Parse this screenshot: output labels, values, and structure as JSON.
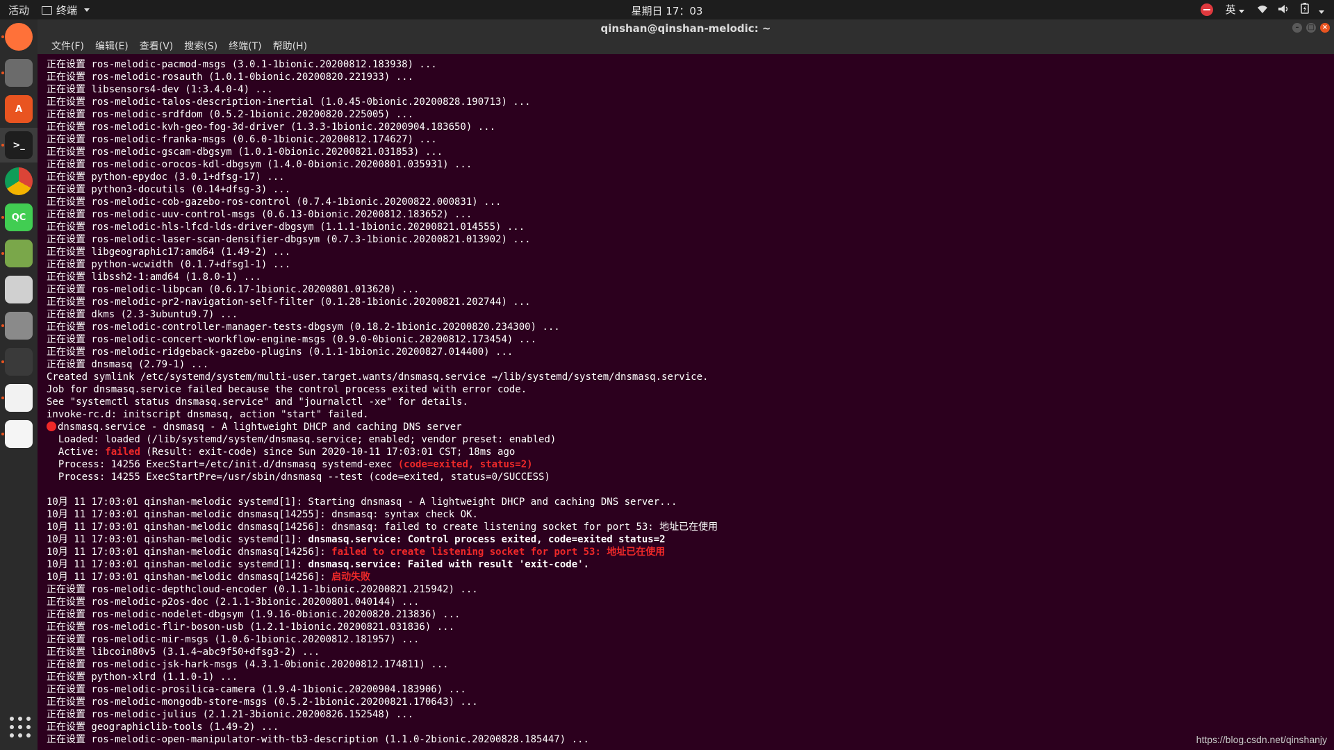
{
  "topbar": {
    "activities": "活动",
    "app_name": "终端",
    "clock": "星期日 17：03",
    "input_method": "英"
  },
  "window": {
    "title": "qinshan@qinshan-melodic: ~",
    "menu": [
      "文件(F)",
      "编辑(E)",
      "查看(V)",
      "搜索(S)",
      "终端(T)",
      "帮助(H)"
    ]
  },
  "dock": [
    {
      "name": "firefox-icon",
      "label": ""
    },
    {
      "name": "files-icon",
      "label": ""
    },
    {
      "name": "software-center-icon",
      "label": "A"
    },
    {
      "name": "terminal-icon",
      "label": ">_"
    },
    {
      "name": "chrome-icon",
      "label": ""
    },
    {
      "name": "qtcreator-icon",
      "label": "QC"
    },
    {
      "name": "image-editor-icon",
      "label": ""
    },
    {
      "name": "camera-icon",
      "label": ""
    },
    {
      "name": "settings-tools-icon",
      "label": ""
    },
    {
      "name": "video-editor-icon",
      "label": ""
    },
    {
      "name": "text-editor-icon",
      "label": ""
    },
    {
      "name": "document-viewer-icon",
      "label": ""
    }
  ],
  "terminal": {
    "lines": [
      [
        {
          "t": "正在设置 ros-melodic-pacmod-msgs (3.0.1-1bionic.20200812.183938) ..."
        }
      ],
      [
        {
          "t": "正在设置 ros-melodic-rosauth (1.0.1-0bionic.20200820.221933) ..."
        }
      ],
      [
        {
          "t": "正在设置 libsensors4-dev (1:3.4.0-4) ..."
        }
      ],
      [
        {
          "t": "正在设置 ros-melodic-talos-description-inertial (1.0.45-0bionic.20200828.190713) ..."
        }
      ],
      [
        {
          "t": "正在设置 ros-melodic-srdfdom (0.5.2-1bionic.20200820.225005) ..."
        }
      ],
      [
        {
          "t": "正在设置 ros-melodic-kvh-geo-fog-3d-driver (1.3.3-1bionic.20200904.183650) ..."
        }
      ],
      [
        {
          "t": "正在设置 ros-melodic-franka-msgs (0.6.0-1bionic.20200812.174627) ..."
        }
      ],
      [
        {
          "t": "正在设置 ros-melodic-gscam-dbgsym (1.0.1-0bionic.20200821.031853) ..."
        }
      ],
      [
        {
          "t": "正在设置 ros-melodic-orocos-kdl-dbgsym (1.4.0-0bionic.20200801.035931) ..."
        }
      ],
      [
        {
          "t": "正在设置 python-epydoc (3.0.1+dfsg-17) ..."
        }
      ],
      [
        {
          "t": "正在设置 python3-docutils (0.14+dfsg-3) ..."
        }
      ],
      [
        {
          "t": "正在设置 ros-melodic-cob-gazebo-ros-control (0.7.4-1bionic.20200822.000831) ..."
        }
      ],
      [
        {
          "t": "正在设置 ros-melodic-uuv-control-msgs (0.6.13-0bionic.20200812.183652) ..."
        }
      ],
      [
        {
          "t": "正在设置 ros-melodic-hls-lfcd-lds-driver-dbgsym (1.1.1-1bionic.20200821.014555) ..."
        }
      ],
      [
        {
          "t": "正在设置 ros-melodic-laser-scan-densifier-dbgsym (0.7.3-1bionic.20200821.013902) ..."
        }
      ],
      [
        {
          "t": "正在设置 libgeographic17:amd64 (1.49-2) ..."
        }
      ],
      [
        {
          "t": "正在设置 python-wcwidth (0.1.7+dfsg1-1) ..."
        }
      ],
      [
        {
          "t": "正在设置 libssh2-1:amd64 (1.8.0-1) ..."
        }
      ],
      [
        {
          "t": "正在设置 ros-melodic-libpcan (0.6.17-1bionic.20200801.013620) ..."
        }
      ],
      [
        {
          "t": "正在设置 ros-melodic-pr2-navigation-self-filter (0.1.28-1bionic.20200821.202744) ..."
        }
      ],
      [
        {
          "t": "正在设置 dkms (2.3-3ubuntu9.7) ..."
        }
      ],
      [
        {
          "t": "正在设置 ros-melodic-controller-manager-tests-dbgsym (0.18.2-1bionic.20200820.234300) ..."
        }
      ],
      [
        {
          "t": "正在设置 ros-melodic-concert-workflow-engine-msgs (0.9.0-0bionic.20200812.173454) ..."
        }
      ],
      [
        {
          "t": "正在设置 ros-melodic-ridgeback-gazebo-plugins (0.1.1-1bionic.20200827.014400) ..."
        }
      ],
      [
        {
          "t": "正在设置 dnsmasq (2.79-1) ..."
        }
      ],
      [
        {
          "t": "Created symlink /etc/systemd/system/multi-user.target.wants/dnsmasq.service →/lib/systemd/system/dnsmasq.service."
        }
      ],
      [
        {
          "t": "Job for dnsmasq.service failed because the control process exited with error code."
        }
      ],
      [
        {
          "t": "See \"systemctl status dnsmasq.service\" and \"journalctl -xe\" for details."
        }
      ],
      [
        {
          "t": "invoke-rc.d: initscript dnsmasq, action \"start\" failed."
        }
      ],
      [
        {
          "bullet": true
        },
        {
          "t": "dnsmasq.service - dnsmasq - A lightweight DHCP and caching DNS server"
        }
      ],
      [
        {
          "t": "  Loaded: loaded (/lib/systemd/system/dnsmasq.service; enabled; vendor preset: enabled)"
        }
      ],
      [
        {
          "t": "  Active: "
        },
        {
          "t": "failed",
          "c": "red bold"
        },
        {
          "t": " (Result: exit-code) since Sun 2020-10-11 17:03:01 CST; 18ms ago"
        }
      ],
      [
        {
          "t": "  Process: 14256 ExecStart=/etc/init.d/dnsmasq systemd-exec "
        },
        {
          "t": "(code=exited, status=2)",
          "c": "red bold"
        }
      ],
      [
        {
          "t": "  Process: 14255 ExecStartPre=/usr/sbin/dnsmasq --test (code=exited, status=0/SUCCESS)"
        }
      ],
      [
        {
          "t": ""
        }
      ],
      [
        {
          "t": "10月 11 17:03:01 qinshan-melodic systemd[1]: Starting dnsmasq - A lightweight DHCP and caching DNS server..."
        }
      ],
      [
        {
          "t": "10月 11 17:03:01 qinshan-melodic dnsmasq[14255]: dnsmasq: syntax check OK."
        }
      ],
      [
        {
          "t": "10月 11 17:03:01 qinshan-melodic dnsmasq[14256]: dnsmasq: failed to create listening socket for port 53: 地址已在使用"
        }
      ],
      [
        {
          "t": "10月 11 17:03:01 qinshan-melodic systemd[1]: "
        },
        {
          "t": "dnsmasq.service: Control process exited, code=exited status=2",
          "c": "bold"
        }
      ],
      [
        {
          "t": "10月 11 17:03:01 qinshan-melodic dnsmasq[14256]: "
        },
        {
          "t": "failed to create listening socket for port 53: 地址已在使用",
          "c": "red bold"
        }
      ],
      [
        {
          "t": "10月 11 17:03:01 qinshan-melodic systemd[1]: "
        },
        {
          "t": "dnsmasq.service: Failed with result 'exit-code'.",
          "c": "bold"
        }
      ],
      [
        {
          "t": "10月 11 17:03:01 qinshan-melodic dnsmasq[14256]: "
        },
        {
          "t": "启动失败",
          "c": "red bold"
        }
      ],
      [
        {
          "t": "正在设置 ros-melodic-depthcloud-encoder (0.1.1-1bionic.20200821.215942) ..."
        }
      ],
      [
        {
          "t": "正在设置 ros-melodic-p2os-doc (2.1.1-3bionic.20200801.040144) ..."
        }
      ],
      [
        {
          "t": "正在设置 ros-melodic-nodelet-dbgsym (1.9.16-0bionic.20200820.213836) ..."
        }
      ],
      [
        {
          "t": "正在设置 ros-melodic-flir-boson-usb (1.2.1-1bionic.20200821.031836) ..."
        }
      ],
      [
        {
          "t": "正在设置 ros-melodic-mir-msgs (1.0.6-1bionic.20200812.181957) ..."
        }
      ],
      [
        {
          "t": "正在设置 libcoin80v5 (3.1.4~abc9f50+dfsg3-2) ..."
        }
      ],
      [
        {
          "t": "正在设置 ros-melodic-jsk-hark-msgs (4.3.1-0bionic.20200812.174811) ..."
        }
      ],
      [
        {
          "t": "正在设置 python-xlrd (1.1.0-1) ..."
        }
      ],
      [
        {
          "t": "正在设置 ros-melodic-prosilica-camera (1.9.4-1bionic.20200904.183906) ..."
        }
      ],
      [
        {
          "t": "正在设置 ros-melodic-mongodb-store-msgs (0.5.2-1bionic.20200821.170643) ..."
        }
      ],
      [
        {
          "t": "正在设置 ros-melodic-julius (2.1.21-3bionic.20200826.152548) ..."
        }
      ],
      [
        {
          "t": "正在设置 geographiclib-tools (1.49-2) ..."
        }
      ],
      [
        {
          "t": "正在设置 ros-melodic-open-manipulator-with-tb3-description (1.1.0-2bionic.20200828.185447) ..."
        }
      ]
    ]
  },
  "watermark": "https://blog.csdn.net/qinshanjy",
  "colors": {
    "terminal_bg": "#2c001e",
    "error_red": "#ef2929",
    "ubuntu_orange": "#e95420"
  }
}
